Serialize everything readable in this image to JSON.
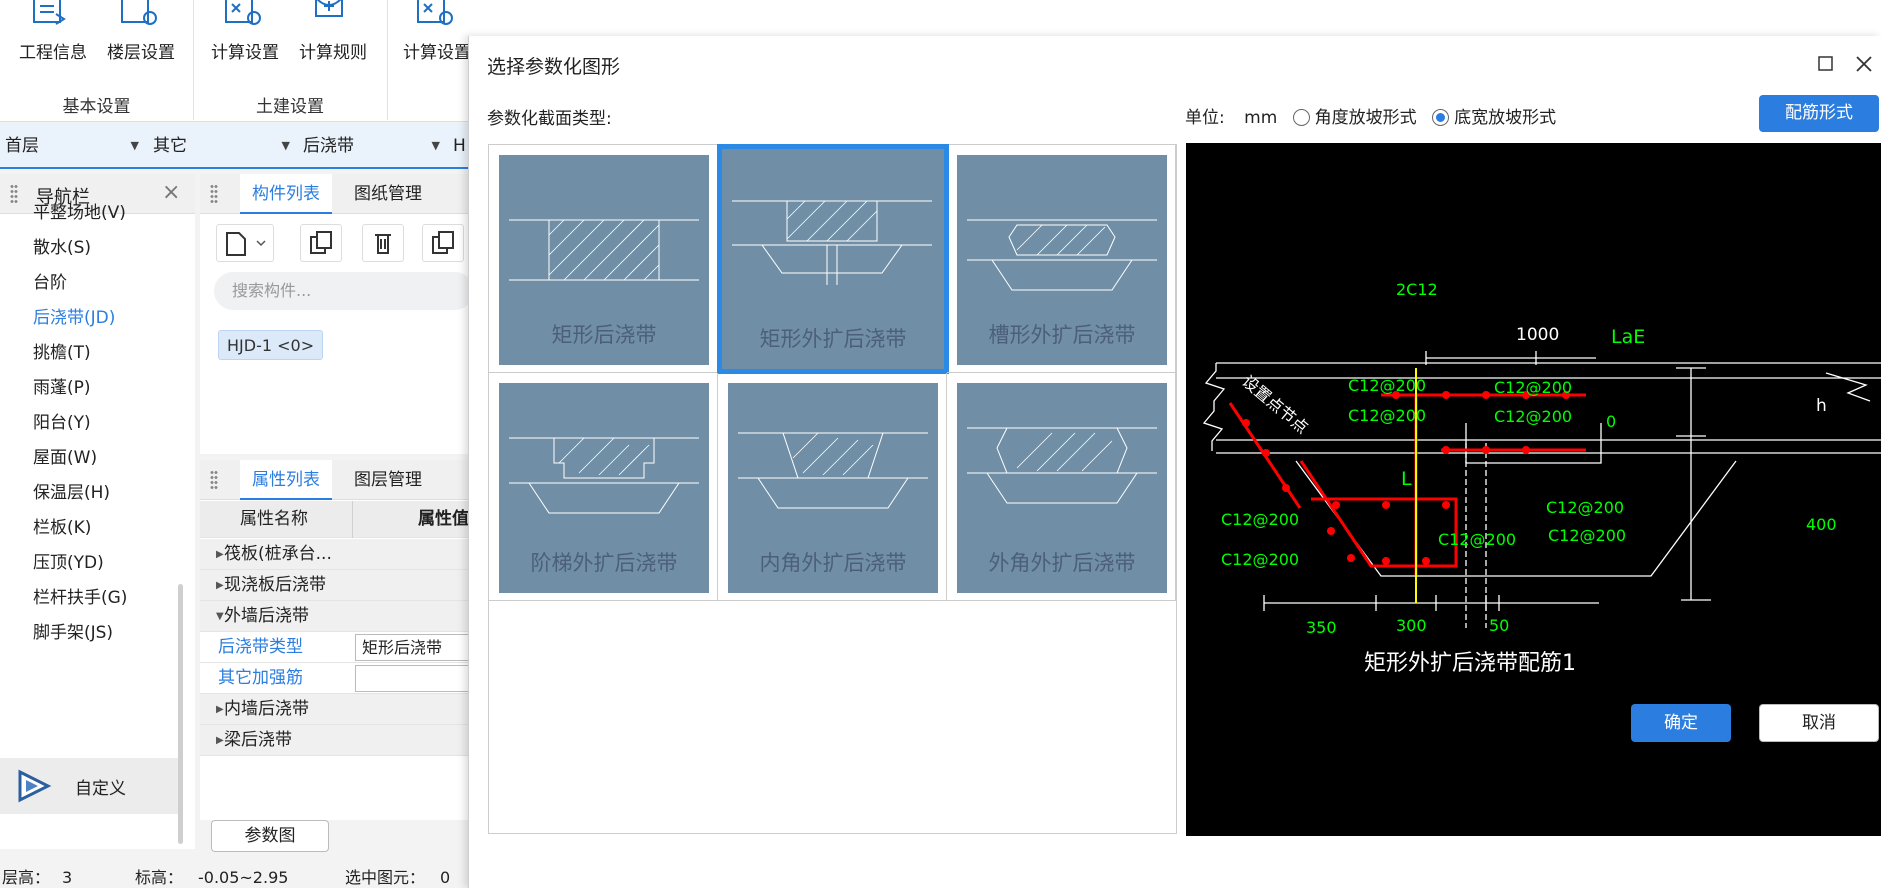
{
  "ribbon": {
    "buttons": [
      {
        "label": "工程信息",
        "icon": "project-info-icon"
      },
      {
        "label": "楼层设置",
        "icon": "floor-settings-icon"
      },
      {
        "label": "计算设置",
        "icon": "calc-settings-icon"
      },
      {
        "label": "计算规则",
        "icon": "calc-rules-icon"
      },
      {
        "label": "计算设置",
        "icon": "calc-settings-icon"
      }
    ],
    "groups": [
      "基本设置",
      "土建设置"
    ]
  },
  "combo": {
    "floor": "首层",
    "category": "其它",
    "component": "后浇带",
    "extra": "H"
  },
  "nav": {
    "title": "导航栏",
    "items": [
      "平整场地(V)",
      "散水(S)",
      "台阶",
      "后浇带(JD)",
      "挑檐(T)",
      "雨蓬(P)",
      "阳台(Y)",
      "屋面(W)",
      "保温层(H)",
      "栏板(K)",
      "压顶(YD)",
      "栏杆扶手(G)",
      "脚手架(JS)"
    ],
    "active_index": 3,
    "custom_label": "自定义"
  },
  "components": {
    "tabs": [
      "构件列表",
      "图纸管理"
    ],
    "search_placeholder": "搜索构件...",
    "chip": "HJD-1 <0>"
  },
  "properties": {
    "tabs": [
      "属性列表",
      "图层管理"
    ],
    "headers": [
      "属性名称",
      "属性值"
    ],
    "rows": [
      {
        "type": "group",
        "label": "筏板(桩承台..."
      },
      {
        "type": "group",
        "label": "现浇板后浇带"
      },
      {
        "type": "group-open",
        "label": "外墙后浇带"
      },
      {
        "type": "field",
        "label": "后浇带类型",
        "value": "矩形后浇带"
      },
      {
        "type": "field",
        "label": "其它加强筋",
        "value": ""
      },
      {
        "type": "group",
        "label": "内墙后浇带"
      },
      {
        "type": "group",
        "label": "梁后浇带"
      }
    ],
    "param_button": "参数图"
  },
  "status": {
    "floor_height_label": "层高：",
    "floor_height": "3",
    "elev_label": "标高：",
    "elev": "-0.05~2.95",
    "selected_label": "选中图元：",
    "selected": "0"
  },
  "dialog": {
    "title": "选择参数化图形",
    "section_type_label": "参数化截面类型:",
    "unit_label": "单位:",
    "unit": "mm",
    "radio_angle": "角度放坡形式",
    "radio_bottom": "底宽放坡形式",
    "rebar_button": "配筋形式",
    "shapes": [
      "矩形后浇带",
      "矩形外扩后浇带",
      "槽形外扩后浇带",
      "阶梯外扩后浇带",
      "内角外扩后浇带",
      "外角外扩后浇带"
    ],
    "selected_index": 1,
    "ok": "确定",
    "cancel": "取消"
  },
  "preview": {
    "title": "矩形外扩后浇带配筋1",
    "labels": {
      "top_rebar": "2C12",
      "width": "1000",
      "lae": "LaE",
      "h": "h",
      "zero": "0",
      "four_hundred": "400",
      "l": "L",
      "setting": "设置点节点",
      "dims": [
        "350",
        "300",
        "50"
      ],
      "rebars": [
        "C12@200",
        "C12@200",
        "C12@200",
        "C12@200",
        "C12@200",
        "C12@200",
        "C12@200",
        "C12@200",
        "C12@200",
        "C12@200"
      ]
    },
    "colors": {
      "green": "#00ff00",
      "red": "#ff0000",
      "yellow": "#ffff00",
      "white": "#ffffff"
    }
  }
}
